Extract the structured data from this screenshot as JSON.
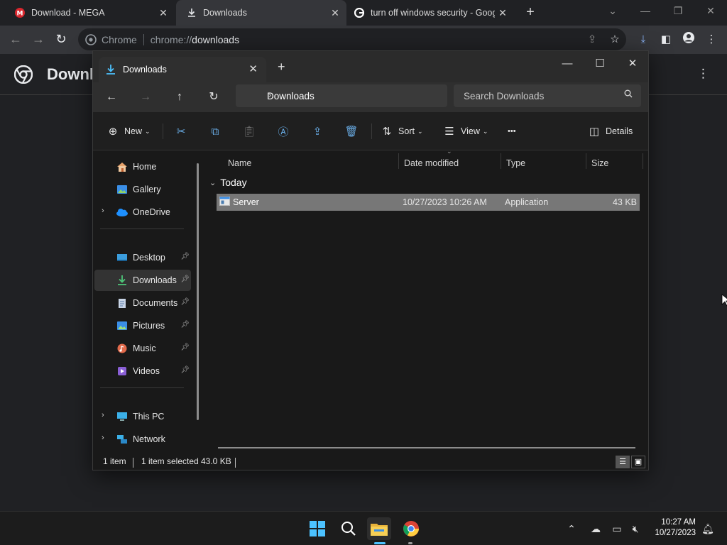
{
  "chrome": {
    "tabs": [
      {
        "title": "Download - MEGA",
        "icon": "mega-icon",
        "close": "✕"
      },
      {
        "title": "Downloads",
        "icon": "download-icon",
        "close": "✕"
      },
      {
        "title": "turn off windows security - Goog",
        "icon": "google-icon",
        "close": "✕"
      }
    ],
    "new_tab": "+",
    "omnibox": {
      "label": "Chrome",
      "url_scheme": "chrome://",
      "url_path": "downloads"
    },
    "page_title": "Downloads"
  },
  "explorer": {
    "tab_title": "Downloads",
    "tab_close": "✕",
    "new_tab": "+",
    "path": "Downloads",
    "search_placeholder": "Search Downloads",
    "commands": {
      "new": "New",
      "sort": "Sort",
      "view": "View",
      "details": "Details",
      "more": "•••"
    },
    "nav": {
      "home": "Home",
      "gallery": "Gallery",
      "onedrive": "OneDrive",
      "desktop": "Desktop",
      "downloads": "Downloads",
      "documents": "Documents",
      "pictures": "Pictures",
      "music": "Music",
      "videos": "Videos",
      "this_pc": "This PC",
      "network": "Network"
    },
    "columns": {
      "name": "Name",
      "date": "Date modified",
      "type": "Type",
      "size": "Size"
    },
    "group": "Today",
    "files": [
      {
        "name": "Server",
        "date": "10/27/2023 10:26 AM",
        "type": "Application",
        "size": "43 KB"
      }
    ],
    "status": {
      "count": "1 item",
      "selected": "1 item selected",
      "size": "43.0 KB"
    }
  },
  "taskbar": {
    "time": "10:27 AM",
    "date": "10/27/2023"
  },
  "colors": {
    "accent": "#4cc2ff",
    "selection": "#777777",
    "chrome_bg": "#202124"
  }
}
